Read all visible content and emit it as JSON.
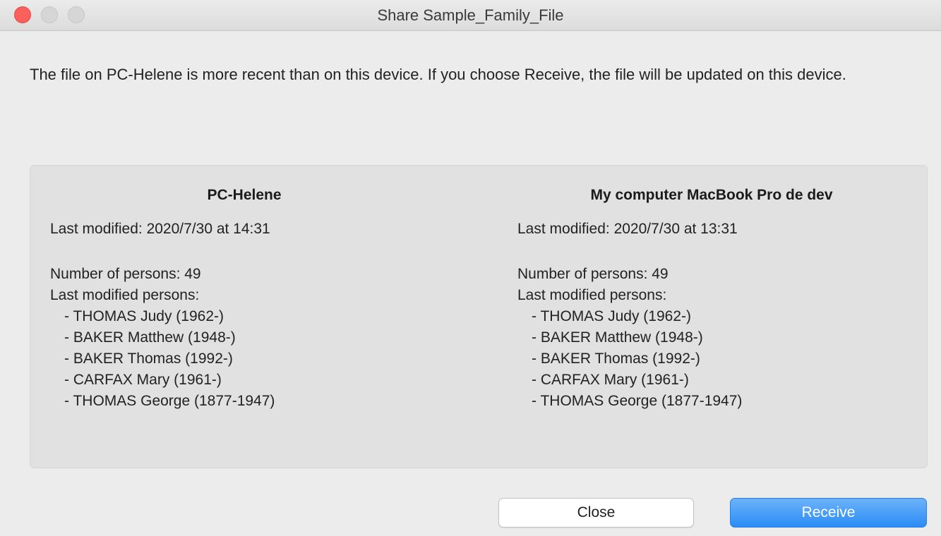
{
  "window": {
    "title": "Share Sample_Family_File"
  },
  "message": "The file on  PC-Helene is more recent than on this device. If you choose Receive, the file will be updated on this device.",
  "left": {
    "title": "PC-Helene",
    "last_modified": "Last modified: 2020/7/30 at 14:31",
    "num_persons": "Number of persons: 49",
    "last_modified_persons_label": "Last modified persons:",
    "persons": [
      "- THOMAS Judy (1962-)",
      "- BAKER Matthew (1948-)",
      "- BAKER Thomas (1992-)",
      "- CARFAX Mary (1961-)",
      "- THOMAS George (1877-1947)"
    ]
  },
  "right": {
    "title": "My computer MacBook Pro de dev",
    "last_modified": "Last modified: 2020/7/30 at 13:31",
    "num_persons": "Number of persons: 49",
    "last_modified_persons_label": "Last modified persons:",
    "persons": [
      "- THOMAS Judy (1962-)",
      "- BAKER Matthew (1948-)",
      "- BAKER Thomas (1992-)",
      "- CARFAX Mary (1961-)",
      "- THOMAS George (1877-1947)"
    ]
  },
  "buttons": {
    "close_label": "Close",
    "receive_label": "Receive"
  },
  "colors": {
    "accent": "#2b8cf5",
    "close_traffic": "#fc605c"
  }
}
